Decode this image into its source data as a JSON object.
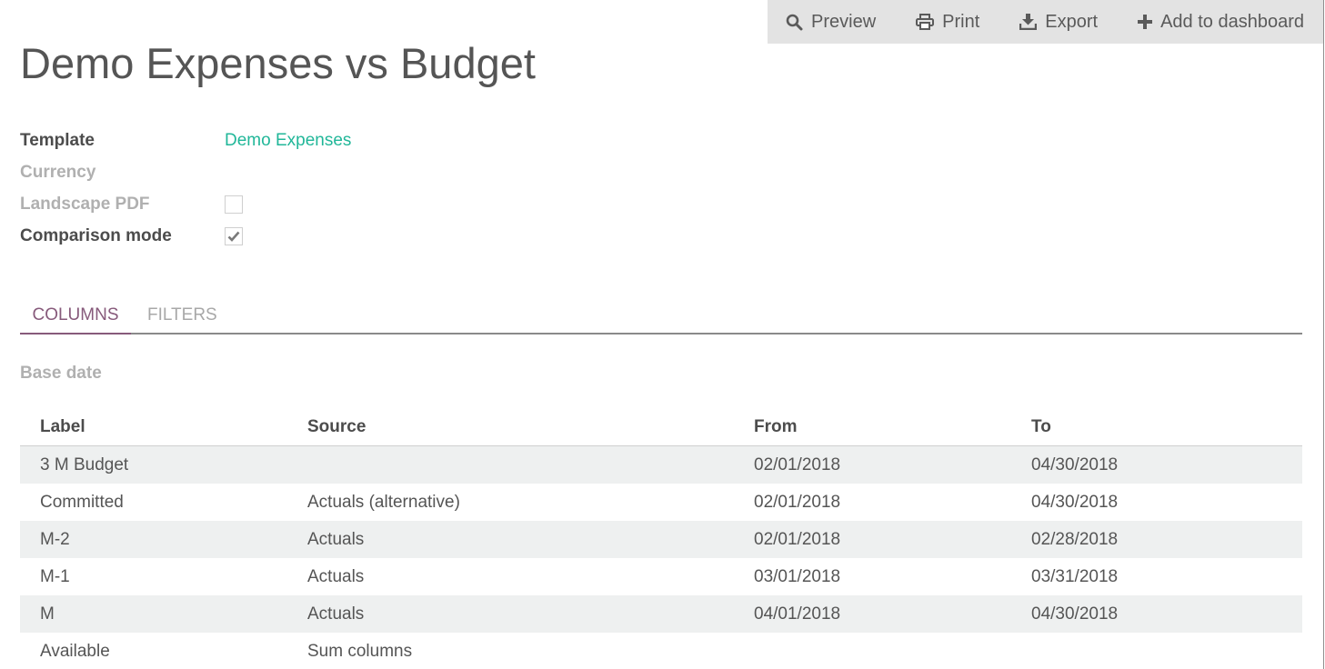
{
  "toolbar": {
    "preview_label": "Preview",
    "print_label": "Print",
    "export_label": "Export",
    "add_dashboard_label": "Add to dashboard"
  },
  "page": {
    "title": "Demo Expenses vs Budget"
  },
  "form": {
    "template_label": "Template",
    "template_value": "Demo Expenses",
    "currency_label": "Currency",
    "landscape_label": "Landscape PDF",
    "landscape_checked": false,
    "comparison_label": "Comparison mode",
    "comparison_checked": true
  },
  "tabs": {
    "columns": "COLUMNS",
    "filters": "FILTERS",
    "active": "columns"
  },
  "columns_tab": {
    "base_date_label": "Base date",
    "headers": {
      "label": "Label",
      "source": "Source",
      "from": "From",
      "to": "To"
    },
    "rows": [
      {
        "label": "3 M Budget",
        "source": "",
        "from": "02/01/2018",
        "to": "04/30/2018"
      },
      {
        "label": "Committed",
        "source": "Actuals (alternative)",
        "from": "02/01/2018",
        "to": "04/30/2018"
      },
      {
        "label": "M-2",
        "source": "Actuals",
        "from": "02/01/2018",
        "to": "02/28/2018"
      },
      {
        "label": "M-1",
        "source": "Actuals",
        "from": "03/01/2018",
        "to": "03/31/2018"
      },
      {
        "label": "M",
        "source": "Actuals",
        "from": "04/01/2018",
        "to": "04/30/2018"
      },
      {
        "label": "Available",
        "source": "Sum columns",
        "from": "",
        "to": ""
      }
    ]
  },
  "colors": {
    "link": "#21b799",
    "accent": "#875a7b",
    "toolbar_bg": "#e3e3e3",
    "row_stripe": "#eef0f0"
  },
  "icons": {
    "preview": "search-icon",
    "print": "print-icon",
    "export": "download-icon",
    "add_dashboard": "plus-icon",
    "checkmark": "checkmark-icon"
  }
}
